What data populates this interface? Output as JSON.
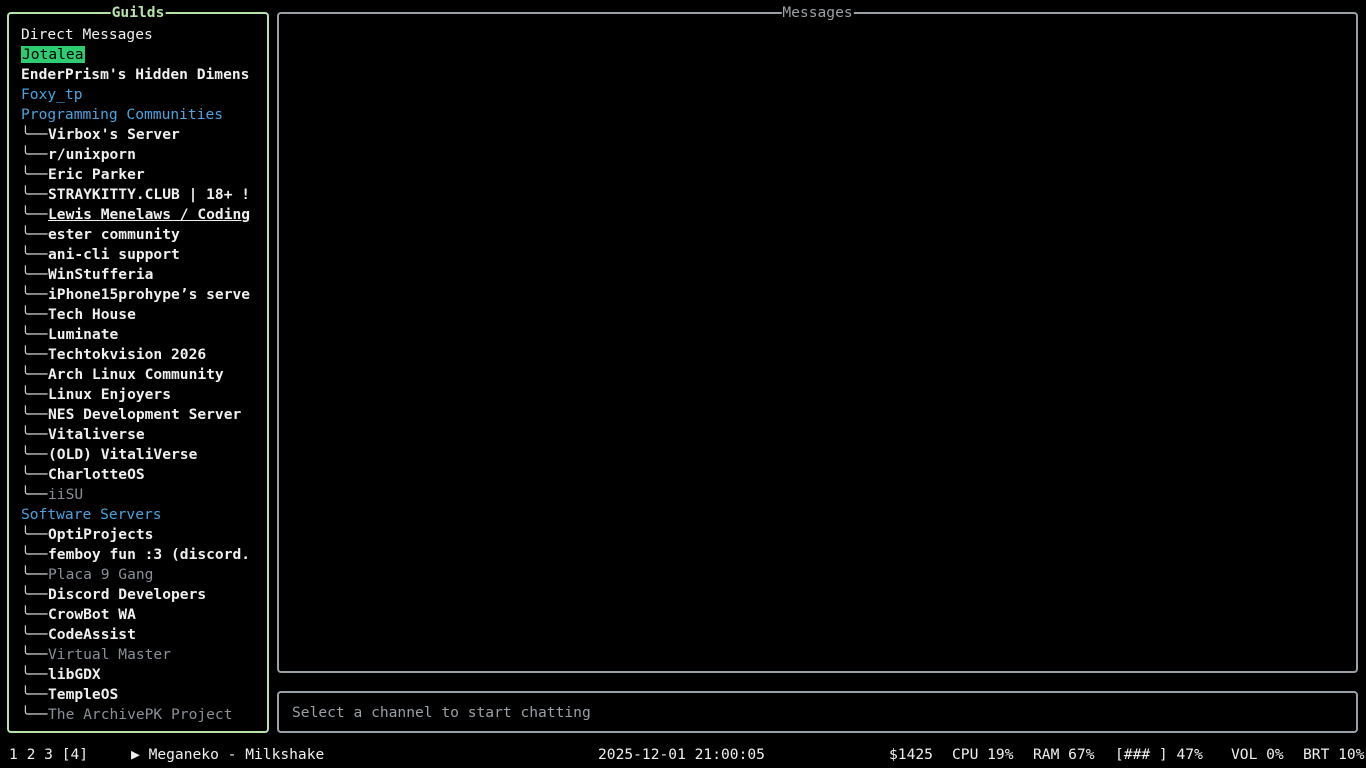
{
  "guilds_panel": {
    "title": "Guilds",
    "items": [
      {
        "label": "Direct Messages",
        "kind": "dm"
      },
      {
        "label": "Jotalea",
        "kind": "selected"
      },
      {
        "label": "EnderPrism's Hidden Dimens",
        "kind": "bold"
      },
      {
        "label": "Foxy_tp",
        "kind": "folder"
      },
      {
        "label": "Programming Communities",
        "kind": "folder"
      },
      {
        "label": "Virbox's Server",
        "kind": "child-bold"
      },
      {
        "label": "r/unixporn",
        "kind": "child-bold"
      },
      {
        "label": "Eric Parker",
        "kind": "child-bold"
      },
      {
        "label": "STRAYKITTY.CLUB | 18+ !",
        "kind": "child-bold"
      },
      {
        "label": "Lewis Menelaws / Coding",
        "kind": "child-bold-underline"
      },
      {
        "label": "ester community",
        "kind": "child-bold"
      },
      {
        "label": "ani-cli support",
        "kind": "child-bold"
      },
      {
        "label": "WinStufferia",
        "kind": "child-bold"
      },
      {
        "label": "iPhone15prohype’s serve",
        "kind": "child-bold"
      },
      {
        "label": "Tech House",
        "kind": "child-bold"
      },
      {
        "label": "Luminate",
        "kind": "child-bold"
      },
      {
        "label": "Techtokvision 2026",
        "kind": "child-bold"
      },
      {
        "label": "Arch Linux Community",
        "kind": "child-bold"
      },
      {
        "label": "Linux Enjoyers",
        "kind": "child-bold"
      },
      {
        "label": "NES Development Server",
        "kind": "child-bold"
      },
      {
        "label": "Vitaliverse",
        "kind": "child-bold"
      },
      {
        "label": "(OLD) VitaliVerse",
        "kind": "child-bold"
      },
      {
        "label": "CharlotteOS",
        "kind": "child-bold"
      },
      {
        "label": "iiSU",
        "kind": "child-dim"
      },
      {
        "label": "Software Servers",
        "kind": "folder"
      },
      {
        "label": "OptiProjects",
        "kind": "child-bold"
      },
      {
        "label": "femboy fun :3 (discord.",
        "kind": "child-bold"
      },
      {
        "label": "Placa 9 Gang",
        "kind": "child-dim"
      },
      {
        "label": "Discord Developers",
        "kind": "child-bold"
      },
      {
        "label": "CrowBot WA",
        "kind": "child-bold"
      },
      {
        "label": "CodeAssist",
        "kind": "child-bold"
      },
      {
        "label": "Virtual Master",
        "kind": "child-dim"
      },
      {
        "label": "libGDX",
        "kind": "child-bold"
      },
      {
        "label": "TempleOS",
        "kind": "child-bold"
      },
      {
        "label": "The ArchivePK Project",
        "kind": "child-dim"
      }
    ],
    "tree_glyph": "╰──"
  },
  "messages_panel": {
    "title": "Messages"
  },
  "input": {
    "placeholder": "Select a channel to start chatting"
  },
  "statusbar": {
    "workspaces": "1  2  3 [4]",
    "now_playing": "▶ Meganeko - Milkshake",
    "datetime": "2025-12-01 21:00:05",
    "money": "$1425",
    "cpu": "CPU 19%",
    "ram": "RAM 67%",
    "battery": "[###  ] 47%",
    "volume": "VOL 0%",
    "brightness": "BRT 10%"
  },
  "colors": {
    "guild_border": "#b7e3a8",
    "panel_border": "#9aa0a6",
    "selected_bg": "#2ecc71",
    "folder": "#4aa3df",
    "dim": "#8a8f98"
  }
}
